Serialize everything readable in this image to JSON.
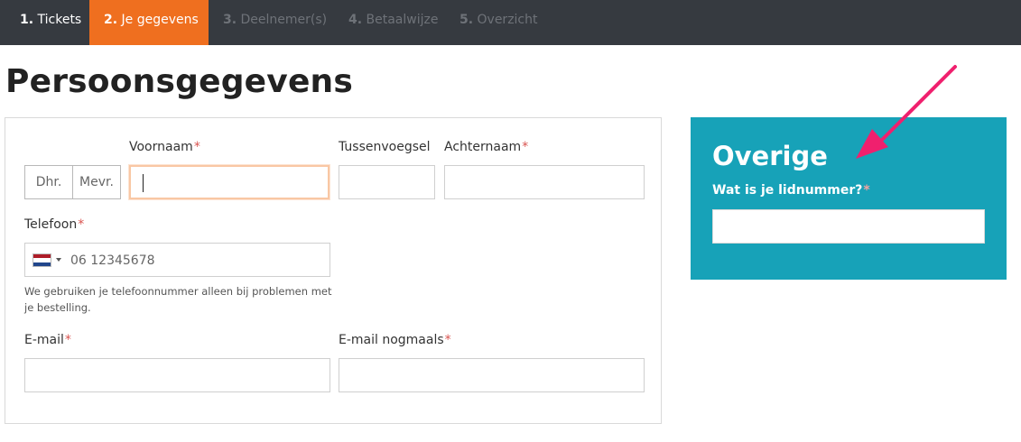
{
  "steps": [
    {
      "num": "1.",
      "label": "Tickets",
      "state": "done"
    },
    {
      "num": "2.",
      "label": "Je gegevens",
      "state": "active"
    },
    {
      "num": "3.",
      "label": "Deelnemer(s)",
      "state": "disabled"
    },
    {
      "num": "4.",
      "label": "Betaalwijze",
      "state": "disabled"
    },
    {
      "num": "5.",
      "label": "Overzicht",
      "state": "disabled"
    }
  ],
  "page": {
    "title": "Persoonsgegevens"
  },
  "form": {
    "salutation": {
      "options": [
        "Dhr.",
        "Mevr."
      ]
    },
    "first_name": {
      "label": "Voornaam",
      "required": "*",
      "value": ""
    },
    "infix": {
      "label": "Tussenvoegsel",
      "value": ""
    },
    "last_name": {
      "label": "Achternaam",
      "required": "*",
      "value": ""
    },
    "phone": {
      "label": "Telefoon",
      "required": "*",
      "placeholder": "06 12345678",
      "country_flag": "netherlands-flag-icon",
      "help": "We gebruiken je telefoonnummer alleen bij problemen met je bestelling."
    },
    "email": {
      "label": "E-mail",
      "required": "*",
      "value": ""
    },
    "email_repeat": {
      "label": "E-mail nogmaals",
      "required": "*",
      "value": ""
    }
  },
  "other": {
    "title": "Overige",
    "member_label": "Wat is je lidnummer?",
    "required": "*",
    "value": ""
  },
  "annotation": {
    "icon": "arrow-icon",
    "color": "#f0206e"
  },
  "colors": {
    "nav_bg": "#363a40",
    "active_step": "#ef6f1f",
    "side_panel": "#17a2b8",
    "required": "#d9534f"
  }
}
